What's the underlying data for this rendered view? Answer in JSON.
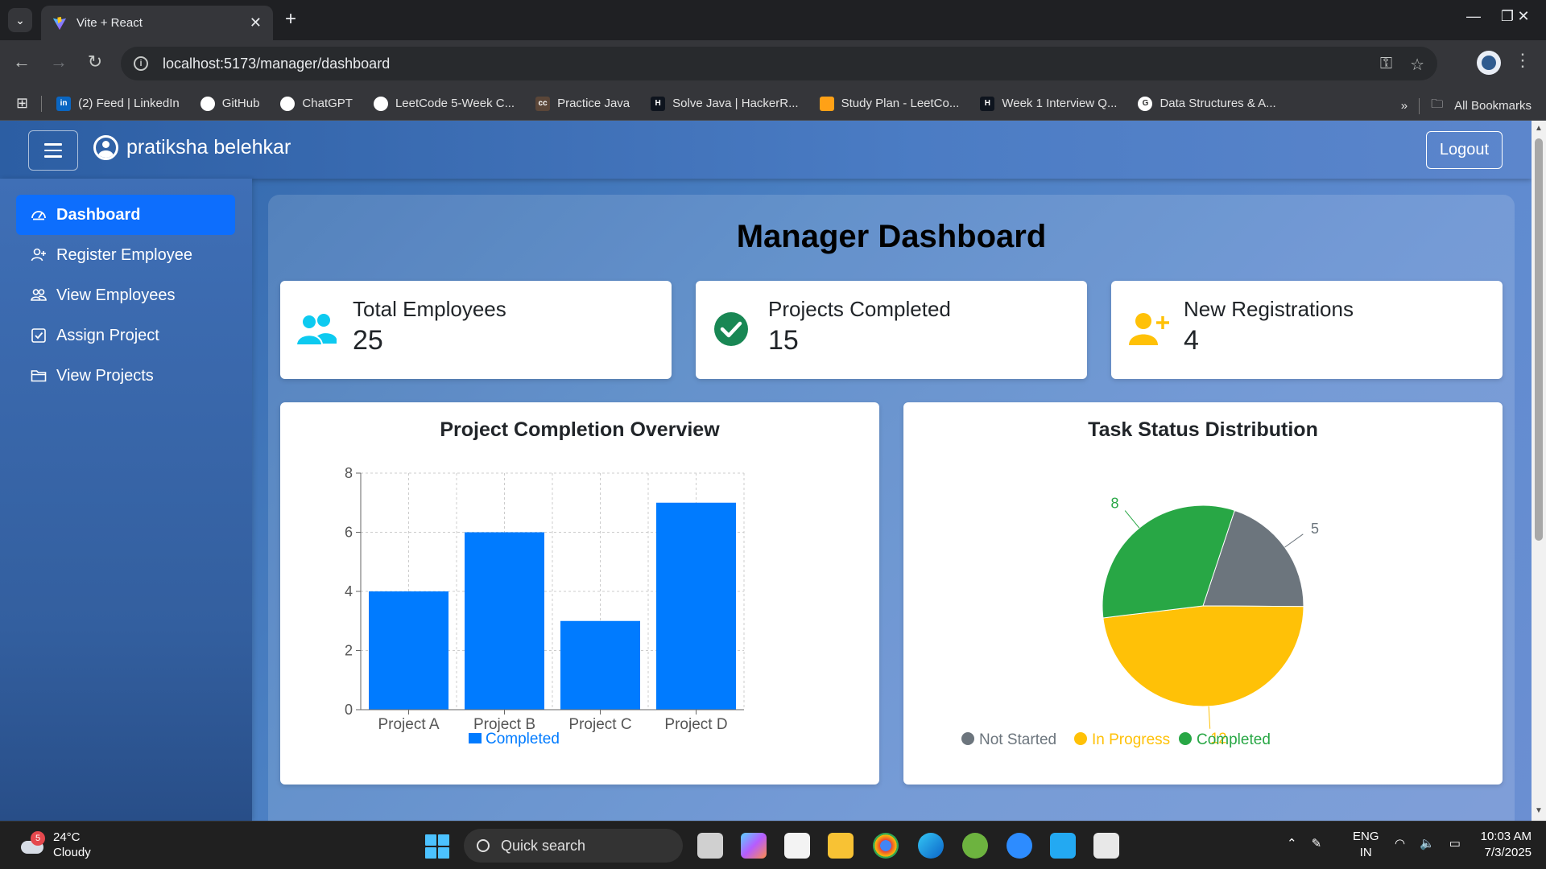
{
  "browser": {
    "tab_title": "Vite + React",
    "url": "localhost:5173/manager/dashboard",
    "bookmarks": [
      {
        "label": "(2) Feed | LinkedIn",
        "icon": "linkedin-icon",
        "color": "#0a66c2",
        "glyph": "in"
      },
      {
        "label": "GitHub",
        "icon": "github-icon",
        "color": "#ffffff",
        "glyph": ""
      },
      {
        "label": "ChatGPT",
        "icon": "chatgpt-icon",
        "color": "#ffffff",
        "glyph": ""
      },
      {
        "label": "LeetCode 5-Week C...",
        "icon": "leetcode-icon",
        "color": "#ffffff",
        "glyph": ""
      },
      {
        "label": "Practice Java",
        "icon": "codechef-icon",
        "color": "#5b4638",
        "glyph": "cc"
      },
      {
        "label": "Solve Java | HackerR...",
        "icon": "hackerrank-icon",
        "color": "#0e141e",
        "glyph": "H"
      },
      {
        "label": "Study Plan - LeetCo...",
        "icon": "leetcode-icon",
        "color": "#ffa116",
        "glyph": ""
      },
      {
        "label": "Week 1 Interview Q...",
        "icon": "hackerrank-icon",
        "color": "#0e141e",
        "glyph": "H"
      },
      {
        "label": "Data Structures & A...",
        "icon": "google-icon",
        "color": "#ffffff",
        "glyph": "G"
      }
    ],
    "all_bookmarks": "All Bookmarks"
  },
  "header": {
    "user_name": "pratiksha belehkar",
    "logout_label": "Logout"
  },
  "sidebar": {
    "items": [
      {
        "label": "Dashboard",
        "icon": "speedometer-icon",
        "active": true
      },
      {
        "label": "Register Employee",
        "icon": "person-add-icon",
        "active": false
      },
      {
        "label": "View Employees",
        "icon": "people-icon",
        "active": false
      },
      {
        "label": "Assign Project",
        "icon": "check-square-icon",
        "active": false
      },
      {
        "label": "View Projects",
        "icon": "folder-icon",
        "active": false
      }
    ]
  },
  "main": {
    "title": "Manager Dashboard",
    "cards": [
      {
        "label": "Total Employees",
        "value": "25",
        "icon": "people-icon",
        "color": "#0dcaf0"
      },
      {
        "label": "Projects Completed",
        "value": "15",
        "icon": "check-circle-icon",
        "color": "#198754"
      },
      {
        "label": "New Registrations",
        "value": "4",
        "icon": "person-plus-icon",
        "color": "#ffc107"
      }
    ]
  },
  "chart_data": [
    {
      "type": "bar",
      "title": "Project Completion Overview",
      "categories": [
        "Project A",
        "Project B",
        "Project C",
        "Project D"
      ],
      "series": [
        {
          "name": "Completed",
          "values": [
            4,
            6,
            3,
            7
          ],
          "color": "#007bff"
        }
      ],
      "yticks": [
        "0",
        "2",
        "4",
        "6",
        "8"
      ],
      "ylim": [
        0,
        8
      ],
      "grid": true,
      "legend": "bottom"
    },
    {
      "type": "pie",
      "title": "Task Status Distribution",
      "labels": [
        "Not Started",
        "In Progress",
        "Completed"
      ],
      "values": [
        5,
        12,
        8
      ],
      "value_labels": [
        "5",
        "12",
        "8"
      ],
      "colors": [
        "#6c757d",
        "#ffc107",
        "#28a745"
      ],
      "legend": "bottom"
    }
  ],
  "taskbar": {
    "temperature": "24°C",
    "weather": "Cloudy",
    "weather_badge": "5",
    "search_label": "Quick search",
    "lang_top": "ENG",
    "lang_bottom": "IN",
    "time": "10:03 AM",
    "date": "7/3/2025"
  }
}
